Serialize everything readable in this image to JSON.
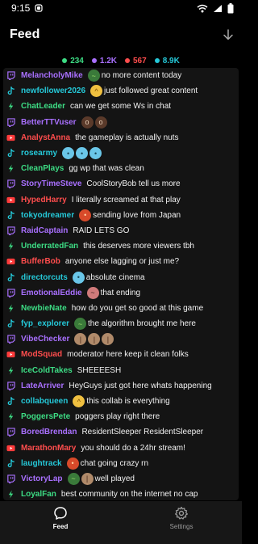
{
  "status_bar": {
    "time": "9:15"
  },
  "header": {
    "title": "Feed"
  },
  "stats": [
    {
      "value": "234",
      "color": "#3ddc84",
      "platform": "kick"
    },
    {
      "value": "1.2K",
      "color": "#a970ff",
      "platform": "twitch"
    },
    {
      "value": "567",
      "color": "#ff4d4d",
      "platform": "youtube"
    },
    {
      "value": "8.9K",
      "color": "#25c8d8",
      "platform": "tiktok"
    }
  ],
  "messages": [
    {
      "platform": "twitch",
      "user": "MelancholyMike",
      "emotes": [
        "snake"
      ],
      "text": "no more content today"
    },
    {
      "platform": "tiktok",
      "user": "newfollower2026",
      "emotes": [
        "angel"
      ],
      "text": "just followed great content"
    },
    {
      "platform": "kick",
      "user": "ChatLeader",
      "emotes": [],
      "text": "can we get some Ws in chat"
    },
    {
      "platform": "twitch",
      "user": "BetterTTVuser",
      "emotes": [
        "eyes",
        "eyes"
      ],
      "text": ""
    },
    {
      "platform": "youtube",
      "user": "AnalystAnna",
      "emotes": [],
      "text": "the gameplay is actually nuts"
    },
    {
      "platform": "tiktok",
      "user": "rosearmy",
      "emotes": [
        "blob",
        "blob",
        "blob"
      ],
      "text": ""
    },
    {
      "platform": "kick",
      "user": "CleanPlays",
      "emotes": [],
      "text": "gg wp that was clean"
    },
    {
      "platform": "twitch",
      "user": "StoryTimeSteve",
      "emotes": [],
      "text": "CoolStoryBob tell us more"
    },
    {
      "platform": "youtube",
      "user": "HypedHarry",
      "emotes": [],
      "text": "I literally screamed at that play"
    },
    {
      "platform": "tiktok",
      "user": "tokyodreamer",
      "emotes": [
        "red"
      ],
      "text": "sending love from Japan"
    },
    {
      "platform": "twitch",
      "user": "RaidCaptain",
      "emotes": [],
      "text": "RAID LETS GO"
    },
    {
      "platform": "kick",
      "user": "UnderratedFan",
      "emotes": [],
      "text": "this deserves more viewers tbh"
    },
    {
      "platform": "youtube",
      "user": "BufferBob",
      "emotes": [],
      "text": "anyone else lagging or just me?"
    },
    {
      "platform": "tiktok",
      "user": "directorcuts",
      "emotes": [
        "blob"
      ],
      "text": "absolute cinema"
    },
    {
      "platform": "twitch",
      "user": "EmotionalEddie",
      "emotes": [
        "sad"
      ],
      "text": "that ending"
    },
    {
      "platform": "kick",
      "user": "NewbieNate",
      "emotes": [],
      "text": "how do you get so good at this game"
    },
    {
      "platform": "tiktok",
      "user": "fyp_explorer",
      "emotes": [
        "snake"
      ],
      "text": "the algorithm brought me here"
    },
    {
      "platform": "twitch",
      "user": "VibeChecker",
      "emotes": [
        "hand",
        "hand",
        "hand"
      ],
      "text": ""
    },
    {
      "platform": "youtube",
      "user": "ModSquad",
      "emotes": [],
      "text": "moderator here keep it clean folks"
    },
    {
      "platform": "kick",
      "user": "IceColdTakes",
      "emotes": [],
      "text": "SHEEEESH"
    },
    {
      "platform": "twitch",
      "user": "LateArriver",
      "emotes": [],
      "text": "HeyGuys just got here whats happening"
    },
    {
      "platform": "tiktok",
      "user": "collabqueen",
      "emotes": [
        "angel"
      ],
      "text": "this collab is everything"
    },
    {
      "platform": "kick",
      "user": "PoggersPete",
      "emotes": [],
      "text": "poggers play right there"
    },
    {
      "platform": "twitch",
      "user": "BoredBrendan",
      "emotes": [],
      "text": "ResidentSleeper ResidentSleeper"
    },
    {
      "platform": "youtube",
      "user": "MarathonMary",
      "emotes": [],
      "text": "you should do a 24hr stream!"
    },
    {
      "platform": "tiktok",
      "user": "laughtrack",
      "emotes": [
        "red"
      ],
      "text": "chat going crazy rn"
    },
    {
      "platform": "twitch",
      "user": "VictoryLap",
      "emotes": [
        "snake",
        "hand"
      ],
      "text": "well played"
    },
    {
      "platform": "kick",
      "user": "LoyalFan",
      "emotes": [],
      "text": "best community on the internet no cap"
    }
  ],
  "tabs": [
    {
      "label": "Feed",
      "icon": "chat-bubble-icon",
      "active": true
    },
    {
      "label": "Settings",
      "icon": "gear-icon",
      "active": false
    }
  ]
}
